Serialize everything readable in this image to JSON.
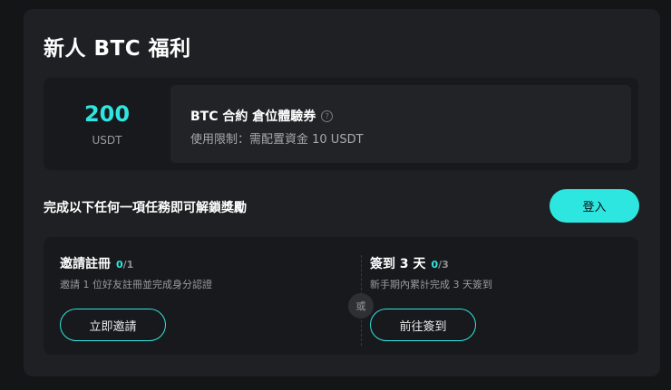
{
  "card": {
    "title": "新人 BTC 福利"
  },
  "voucher": {
    "amount": "200",
    "currency": "USDT",
    "name": "BTC 合約 倉位體驗券",
    "help_icon": "question-circle-icon",
    "limit": "使用限制：需配置資金 10 USDT"
  },
  "tasks": {
    "heading": "完成以下任何一項任務即可解鎖獎勵",
    "login_label": "登入",
    "or_label": "或",
    "items": [
      {
        "title": "邀請註冊",
        "progress_done": "0",
        "progress_total": "/1",
        "description": "邀請 1 位好友註冊並完成身分認證",
        "button_label": "立即邀請"
      },
      {
        "title": "簽到 3 天",
        "progress_done": "0",
        "progress_total": "/3",
        "description": "新手期內累計完成 3 天簽到",
        "button_label": "前往簽到"
      }
    ]
  },
  "colors": {
    "accent": "#2ee6e0",
    "card_bg": "#1f2023",
    "panel_bg": "#18191c"
  }
}
